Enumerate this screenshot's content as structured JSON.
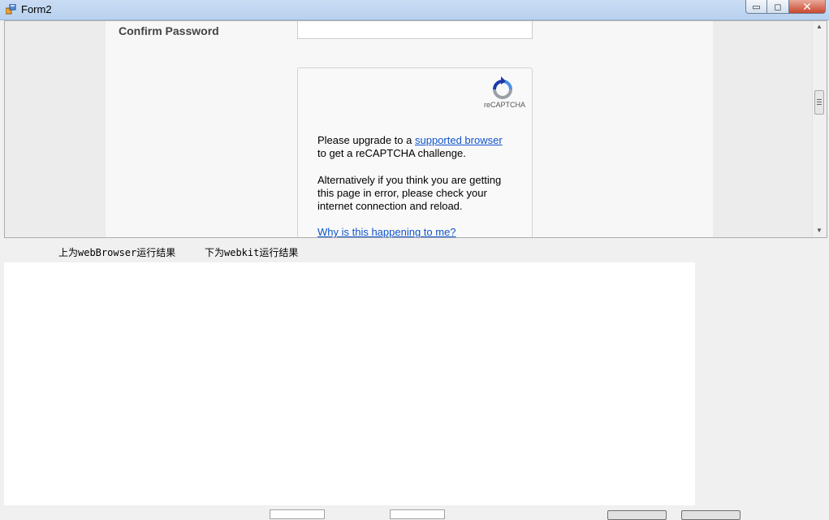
{
  "window": {
    "title": "Form2",
    "minimize_glyph": "▭",
    "maximize_glyph": "◻",
    "close_glyph": "✕"
  },
  "browser": {
    "confirm_password_label": "Confirm Password",
    "recaptcha_brand": "reCAPTCHA",
    "captcha_text_1_prefix": "Please upgrade to a ",
    "captcha_link_supported": "supported browser",
    "captcha_text_1_suffix": "to get a reCAPTCHA challenge.",
    "captcha_text_2": "Alternatively if you think you are getting this page in error, please check your internet connection and reload.",
    "captcha_link_why": "Why is this happening to me?"
  },
  "labels": {
    "webbrowser_result": "上为webBrowser运行结果",
    "webkit_result": "下为webkit运行结果"
  },
  "icons": {
    "app": "form-app-icon",
    "recaptcha": "recaptcha-logo-icon",
    "scroll_up": "scroll-up-arrow-icon",
    "scroll_down": "scroll-down-arrow-icon"
  },
  "colors": {
    "link": "#1155cc",
    "titlebar": "#c9dcf3",
    "close_button": "#c9462c"
  }
}
